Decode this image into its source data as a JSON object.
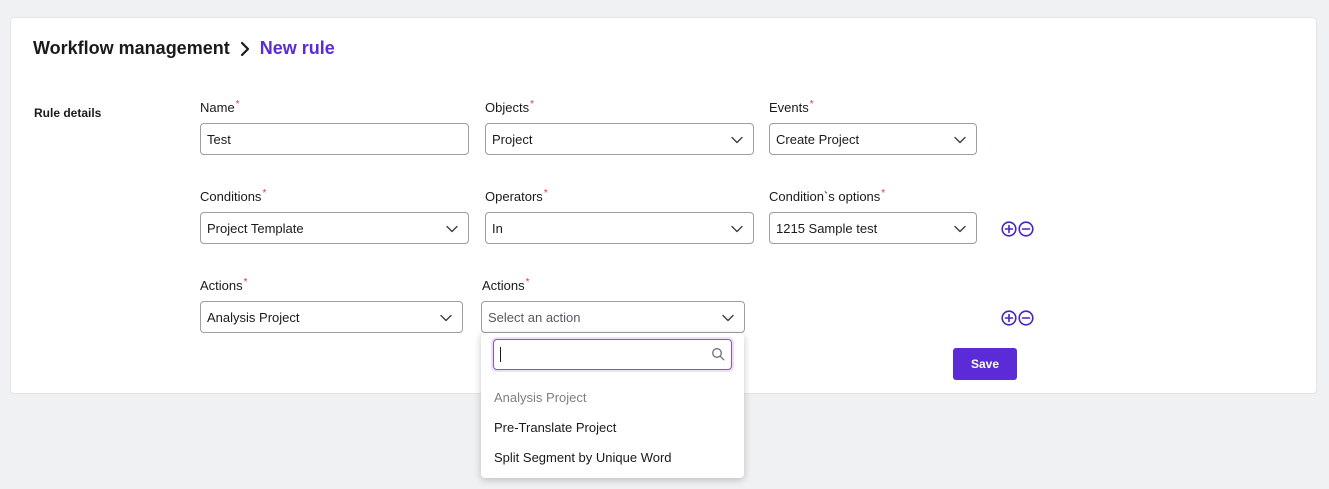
{
  "breadcrumb": {
    "root": "Workflow management",
    "current": "New rule"
  },
  "section": {
    "label": "Rule details"
  },
  "fields": {
    "name": {
      "label": "Name",
      "required_mark": "*",
      "value": "Test"
    },
    "objects": {
      "label": "Objects",
      "required_mark": "*",
      "value": "Project"
    },
    "events": {
      "label": "Events",
      "required_mark": "*",
      "value": "Create Project"
    },
    "conditions": {
      "label": "Conditions",
      "required_mark": "*",
      "value": "Project Template"
    },
    "operators": {
      "label": "Operators",
      "required_mark": "*",
      "value": "In"
    },
    "condition_options": {
      "label": "Condition`s options",
      "required_mark": "*",
      "value": "1215 Sample test"
    },
    "actions1": {
      "label": "Actions",
      "required_mark": "*",
      "value": "Analysis Project"
    },
    "actions2": {
      "label": "Actions",
      "required_mark": "*",
      "placeholder": "Select an action"
    }
  },
  "dropdown": {
    "search_value": "",
    "options": [
      {
        "label": "Analysis Project",
        "state": "selected"
      },
      {
        "label": "Pre-Translate Project",
        "state": "normal"
      },
      {
        "label": "Split Segment by Unique Word",
        "state": "normal"
      }
    ]
  },
  "buttons": {
    "save_label": "Save"
  },
  "icons": {
    "add": "plus-circle-icon",
    "remove": "minus-circle-icon",
    "chevron": "chevron-down-icon",
    "search": "search-icon",
    "breadcrumb_separator": "chevron-right-icon"
  },
  "colors": {
    "accent": "#5a2bd6",
    "required": "#e53935",
    "background": "#f0f1f2"
  }
}
